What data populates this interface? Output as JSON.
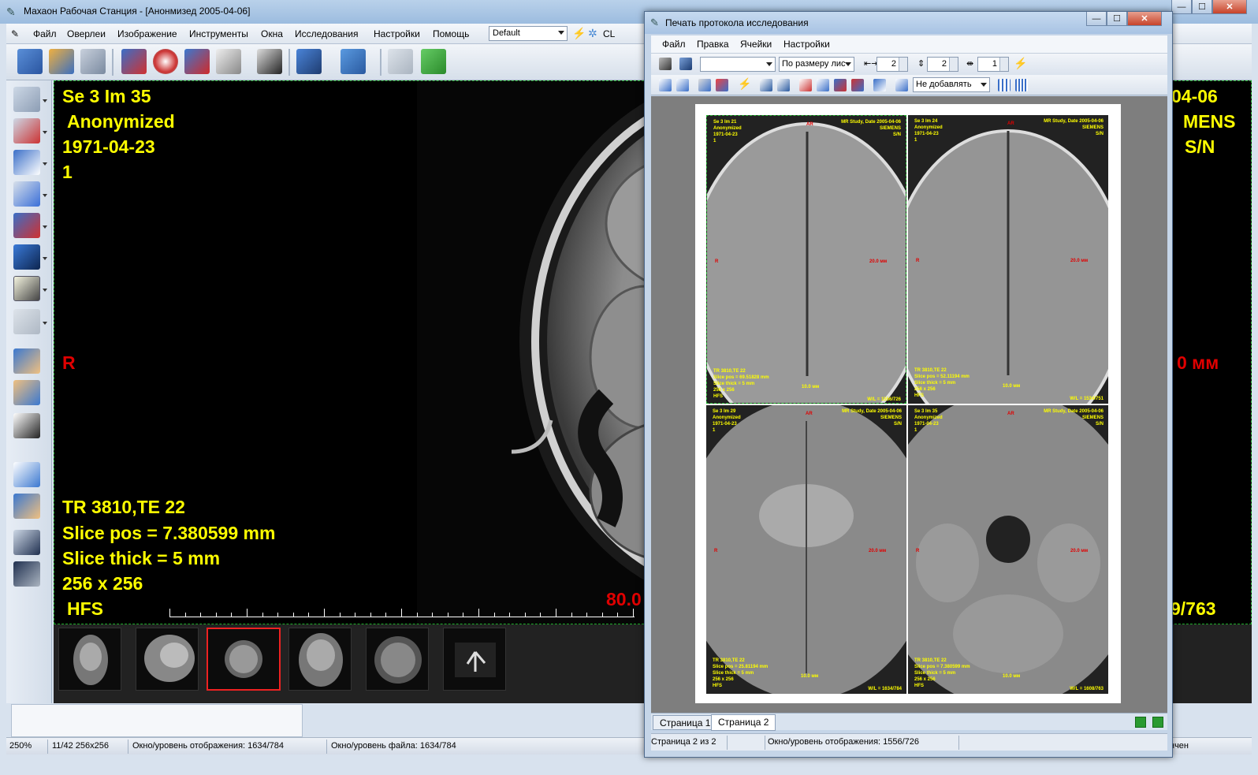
{
  "main_window": {
    "title": "Махаон Рабочая Станция - [Анонмизед  2005-04-06]",
    "menu": [
      "Файл",
      "Оверлеи",
      "Изображение",
      "Инструменты",
      "Окна",
      "Исследования",
      "Настройки",
      "Помощь"
    ],
    "preset": "Default",
    "cl_label": "CL",
    "viewer_overlay": {
      "series_image": "Se 3 Im 35",
      "patient_name": "Anonymized",
      "birth_date": "1971-04-23",
      "index": "1",
      "orientation_left": "R",
      "tr_te": "TR 3810,TE 22",
      "slice_pos": "Slice pos = 7.380599 mm",
      "slice_thick": "Slice thick = 5 mm",
      "matrix": "256 x 256",
      "position": "HFS",
      "scale_label": "80.0",
      "date_right": "04-06",
      "vendor_right": "MENS",
      "sn_right": "S/N",
      "mm_right": "0 мм",
      "window_right": "9/763"
    },
    "thumbnails_count": 6,
    "selected_thumbnail": 3
  },
  "statusbar": {
    "zoom": "250%",
    "image_info": "11/42 256x256",
    "display_window": "Окно/уровень отображения: 1634/784",
    "file_window": "Окно/уровень файла: 1634/784",
    "right_text": "нчен"
  },
  "print_dialog": {
    "title": "Печать протокола исследования",
    "menu": [
      "Файл",
      "Правка",
      "Ячейки",
      "Настройки"
    ],
    "fit_select": "По размеру лис",
    "spin_cols": "2",
    "spin_rows": "2",
    "spin_count": "1",
    "add_mode": "Не добавлять",
    "cells": [
      {
        "se": "Se 3 Im 21",
        "name": "Anonymized",
        "date": "1971-04-23",
        "idx": "1",
        "study": "MR Study, Date 2005-04-06",
        "vendor": "SIEMENS",
        "sn": "S/N",
        "orient_top": "AR",
        "orient_top2": "0",
        "left": "R",
        "mm": "20.0 мм",
        "tr": "TR 3810,TE 22",
        "pos": "Slice pos = 69.51828 mm",
        "thick": "Slice thick = 5 mm",
        "matrix": "256 x 256",
        "hfs": "HFS",
        "scale": "10.0 мм",
        "ww": "W/L = 1556/726"
      },
      {
        "se": "Se 3 Im 24",
        "name": "Anonymized",
        "date": "1971-04-23",
        "idx": "1",
        "study": "MR Study, Date 2005-04-06",
        "vendor": "SIEMENS",
        "sn": "S/N",
        "orient_top": "AR",
        "orient_top2": "1",
        "left": "R",
        "mm": "20.0 мм",
        "tr": "TR 3810,TE 22",
        "pos": "Slice pos = 52.11194 mm",
        "thick": "Slice thick = 5 mm",
        "matrix": "256 x 256",
        "hfs": "HFS",
        "scale": "10.0 мм",
        "ww": "W/L = 1534/751"
      },
      {
        "se": "Se 3 Im 29",
        "name": "Anonymized",
        "date": "1971-04-23",
        "idx": "1",
        "study": "MR Study, Date 2005-04-06",
        "vendor": "SIEMENS",
        "sn": "S/N",
        "orient_top": "AR",
        "orient_top2": "2",
        "left": "R",
        "mm": "20.0 мм",
        "tr": "TR 3810,TE 22",
        "pos": "Slice pos = 25.81194 mm",
        "thick": "Slice thick = 5 mm",
        "matrix": "256 x 256",
        "hfs": "HFS",
        "scale": "10.0 мм",
        "ww": "W/L = 1634/784"
      },
      {
        "se": "Se 3 Im 35",
        "name": "Anonymized",
        "date": "1971-04-23",
        "idx": "1",
        "study": "MR Study, Date 2005-04-06",
        "vendor": "SIEMENS",
        "sn": "S/N",
        "orient_top": "AR",
        "orient_top2": "2",
        "left": "R",
        "mm": "20.0 мм",
        "tr": "TR 3810,TE 22",
        "pos": "Slice pos = 7.380599 mm",
        "thick": "Slice thick = 5 mm",
        "matrix": "256 x 256",
        "hfs": "HFS",
        "scale": "10.0 мм",
        "ww": "W/L = 1608/763"
      }
    ],
    "tabs": [
      "Страница 1",
      "Страница 2"
    ],
    "active_tab": 1,
    "status_page": "Страница 2 из 2",
    "status_window": "Окно/уровень отображения: 1556/726"
  },
  "colors": {
    "overlay_yellow": "#ffff00",
    "overlay_red": "#e00000",
    "frame_green": "#1fae2b",
    "selection_red": "#e22222"
  }
}
